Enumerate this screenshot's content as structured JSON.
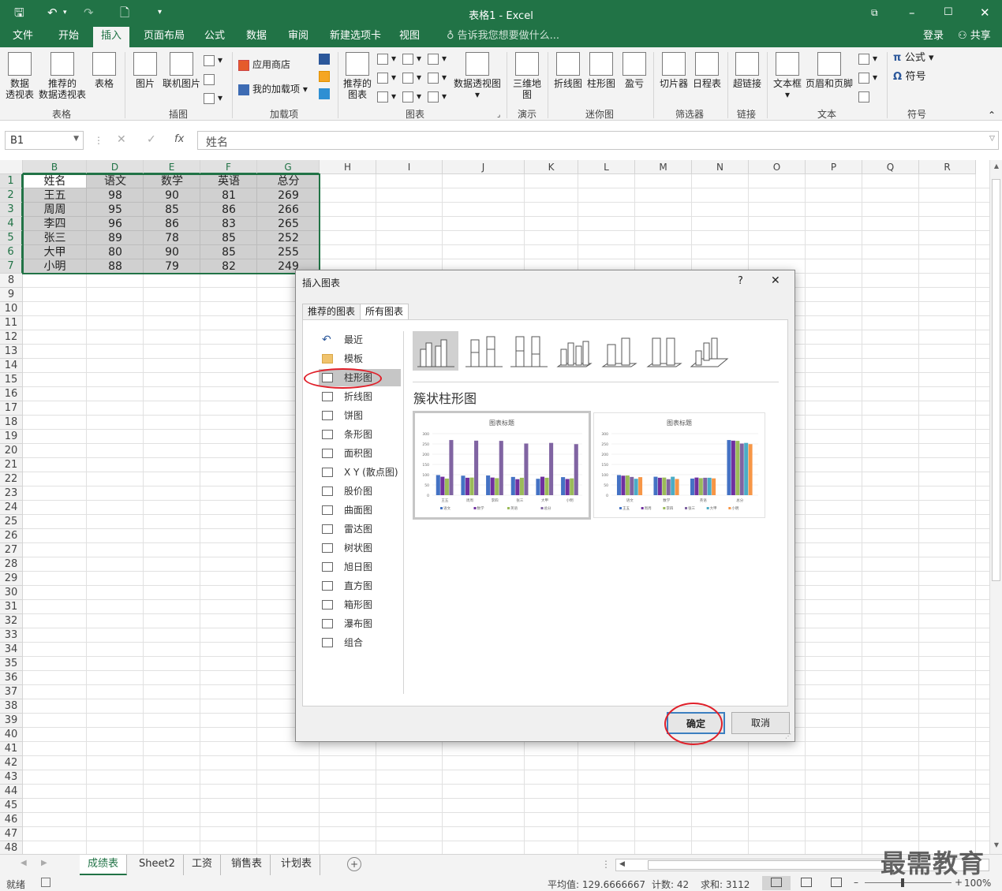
{
  "window": {
    "title": "表格1 - Excel"
  },
  "menu_tabs": [
    "文件",
    "开始",
    "插入",
    "页面布局",
    "公式",
    "数据",
    "审阅",
    "新建选项卡",
    "视图"
  ],
  "tell_me": "告诉我您想要做什么...",
  "account": {
    "login": "登录",
    "share": "共享"
  },
  "ribbon": {
    "groups": [
      "表格",
      "插图",
      "加载项",
      "图表",
      "演示",
      "迷你图",
      "筛选器",
      "链接",
      "文本",
      "符号"
    ],
    "table_btns": [
      "数据\n透视表",
      "推荐的\n数据透视表",
      "表格"
    ],
    "illus_btns": [
      "图片",
      "联机图片"
    ],
    "addin_btns": [
      "应用商店",
      "我的加载项"
    ],
    "chart_btns": [
      "推荐的\n图表",
      "数据透视图"
    ],
    "demo_btn": "三维地\n图",
    "spark_btns": [
      "折线图",
      "柱形图",
      "盈亏"
    ],
    "filter_btns": [
      "切片器",
      "日程表"
    ],
    "link_btn": "超链接",
    "text_btns": [
      "文本框",
      "页眉和页脚"
    ],
    "symbol_btns": [
      "公式",
      "符号"
    ]
  },
  "formula_bar": {
    "name_box": "B1",
    "fx": "fx",
    "content": "姓名"
  },
  "columns": [
    "B",
    "D",
    "E",
    "F",
    "G",
    "H",
    "I",
    "J",
    "K",
    "L",
    "M",
    "N",
    "O",
    "P",
    "Q",
    "R"
  ],
  "selected_columns": [
    "B",
    "D",
    "E",
    "F",
    "G"
  ],
  "rows": [
    "1",
    "2",
    "3",
    "4",
    "5",
    "6",
    "7",
    "8",
    "9",
    "10",
    "11",
    "12",
    "13",
    "14",
    "15",
    "16",
    "17",
    "18",
    "19",
    "20",
    "21",
    "22",
    "23",
    "24",
    "25",
    "26",
    "27",
    "28",
    "29",
    "30",
    "31",
    "32",
    "33",
    "34",
    "35",
    "36",
    "37",
    "38",
    "39",
    "40",
    "41",
    "42",
    "43",
    "44",
    "45",
    "46",
    "47",
    "48"
  ],
  "table": {
    "header": [
      "姓名",
      "语文",
      "数学",
      "英语",
      "总分"
    ],
    "rows": [
      [
        "王五",
        "98",
        "90",
        "81",
        "269"
      ],
      [
        "周周",
        "95",
        "85",
        "86",
        "266"
      ],
      [
        "李四",
        "96",
        "86",
        "83",
        "265"
      ],
      [
        "张三",
        "89",
        "78",
        "85",
        "252"
      ],
      [
        "大甲",
        "80",
        "90",
        "85",
        "255"
      ],
      [
        "小明",
        "88",
        "79",
        "82",
        "249"
      ]
    ]
  },
  "dialog": {
    "title": "插入图表",
    "help": "?",
    "close": "✕",
    "tabs": [
      "推荐的图表",
      "所有图表"
    ],
    "active_tab": "所有图表",
    "chart_types": [
      "最近",
      "模板",
      "柱形图",
      "折线图",
      "饼图",
      "条形图",
      "面积图",
      "X Y (散点图)",
      "股价图",
      "曲面图",
      "雷达图",
      "树状图",
      "旭日图",
      "直方图",
      "箱形图",
      "瀑布图",
      "组合"
    ],
    "selected_type": "柱形图",
    "subtype_title": "簇状柱形图",
    "preview_title": "图表标题",
    "ok": "确定",
    "cancel": "取消"
  },
  "chart_data": [
    {
      "type": "bar",
      "title": "图表标题",
      "categories": [
        "王五",
        "周周",
        "李四",
        "张三",
        "大甲",
        "小明"
      ],
      "series": [
        {
          "name": "语文",
          "values": [
            98,
            95,
            96,
            89,
            80,
            88
          ]
        },
        {
          "name": "数学",
          "values": [
            90,
            85,
            86,
            78,
            90,
            79
          ]
        },
        {
          "name": "英语",
          "values": [
            81,
            86,
            83,
            85,
            85,
            82
          ]
        },
        {
          "name": "总分",
          "values": [
            269,
            266,
            265,
            252,
            255,
            249
          ]
        }
      ],
      "ylim": [
        0,
        300
      ],
      "yticks": [
        "0",
        "50",
        "100",
        "150",
        "200",
        "250",
        "300"
      ]
    },
    {
      "type": "bar",
      "title": "图表标题",
      "categories": [
        "语文",
        "数学",
        "英语",
        "总分"
      ],
      "series": [
        {
          "name": "王五",
          "values": [
            98,
            90,
            81,
            269
          ]
        },
        {
          "name": "周周",
          "values": [
            95,
            85,
            86,
            266
          ]
        },
        {
          "name": "李四",
          "values": [
            96,
            86,
            83,
            265
          ]
        },
        {
          "name": "张三",
          "values": [
            89,
            78,
            85,
            252
          ]
        },
        {
          "name": "大甲",
          "values": [
            80,
            90,
            85,
            255
          ]
        },
        {
          "name": "小明",
          "values": [
            88,
            79,
            82,
            249
          ]
        }
      ],
      "ylim": [
        0,
        300
      ],
      "yticks": [
        "0",
        "50",
        "100",
        "150",
        "200",
        "250",
        "300"
      ]
    }
  ],
  "sheet_tabs": [
    "成绩表",
    "Sheet2",
    "工资",
    "销售表",
    "计划表"
  ],
  "active_sheet": "成绩表",
  "status": {
    "ready": "就绪",
    "average": "平均值: 129.6666667",
    "count": "计数: 42",
    "sum": "求和: 3112",
    "zoom": "100%"
  },
  "watermark": "最需教育",
  "colors": {
    "excel_green": "#217346",
    "series": [
      "#4472c4",
      "#70309f",
      "#9bbb59",
      "#8064a2",
      "#4bacc6",
      "#f79646"
    ]
  }
}
